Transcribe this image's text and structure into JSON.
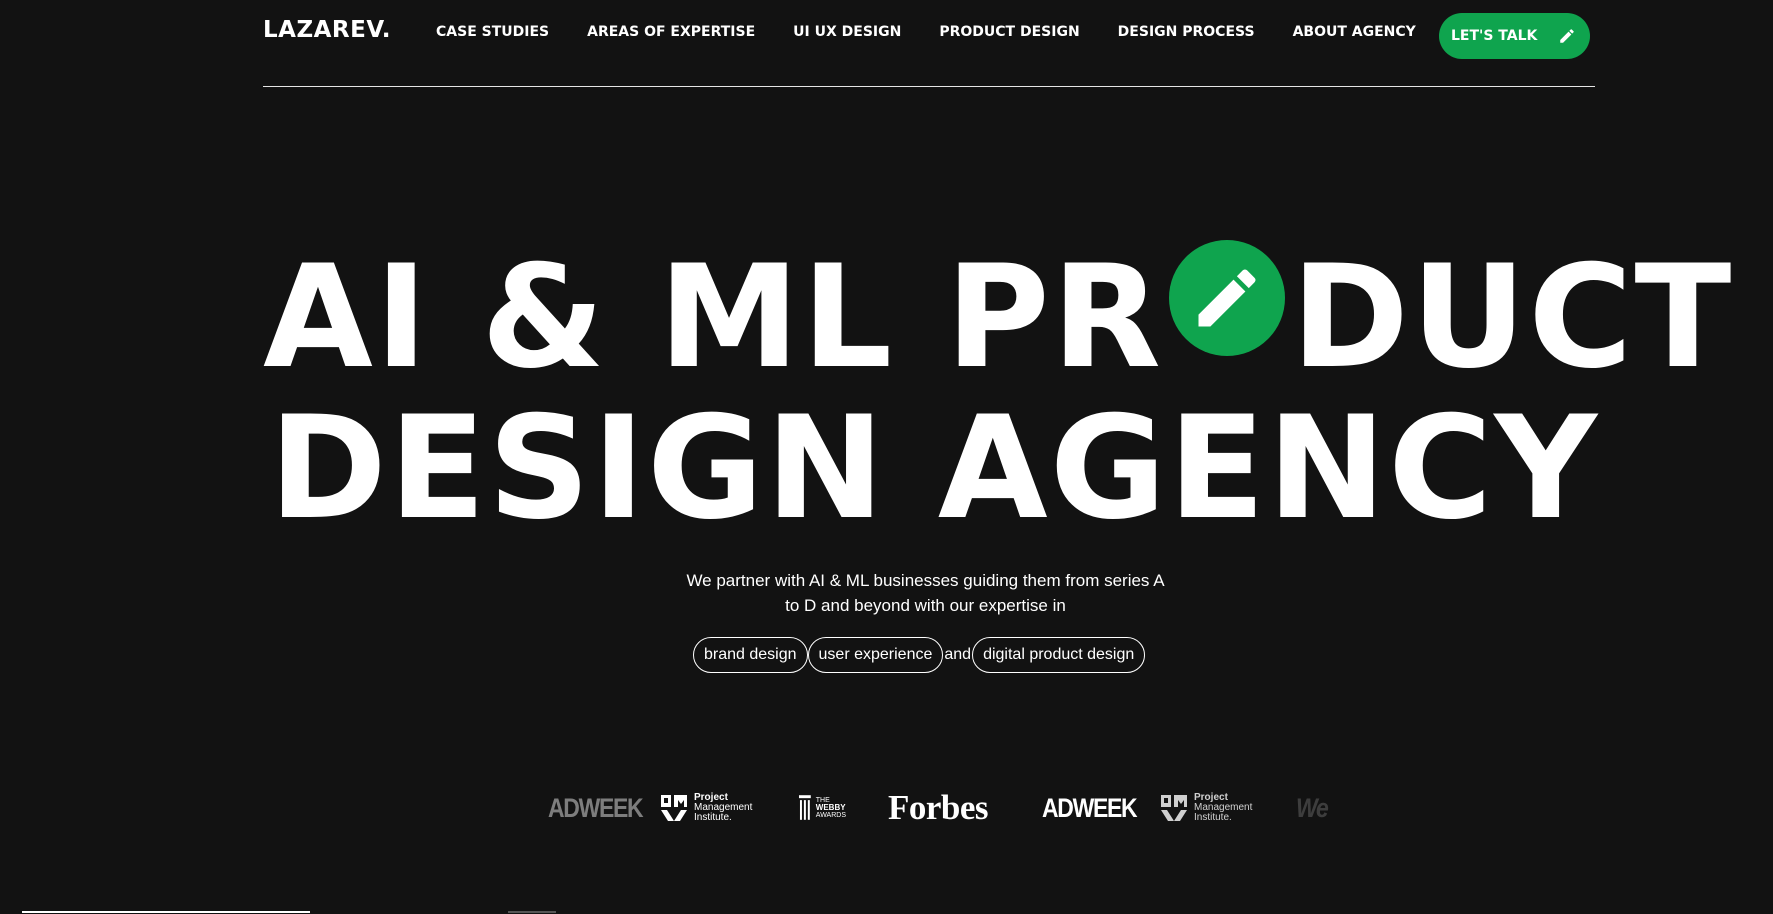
{
  "header": {
    "logo": "LAZAREV.",
    "nav": [
      {
        "label": "CASE STUDIES"
      },
      {
        "label": "AREAS OF EXPERTISE"
      },
      {
        "label": "UI UX DESIGN"
      },
      {
        "label": "PRODUCT DESIGN"
      },
      {
        "label": "DESIGN PROCESS"
      },
      {
        "label": "ABOUT AGENCY"
      }
    ],
    "cta_label": "LET'S TALK",
    "cta_icon": "pencil-icon"
  },
  "hero": {
    "line1_a": "AI & ML PR",
    "line1_b": "DUCT",
    "line2": "DESIGN AGENCY",
    "badge_icon": "pencil-icon",
    "description": "We partner with AI & ML businesses guiding them from series A to D and beyond with our expertise in",
    "tags": [
      "brand design",
      "user experience",
      "digital product design"
    ],
    "and_text": "and"
  },
  "logos": {
    "adweek": "ADWEEK",
    "pmi_line1": "Project",
    "pmi_line2": "Management",
    "pmi_line3": "Institute.",
    "webby_line1": "THE",
    "webby_line2": "WEBBY",
    "webby_line3": "AWARDS",
    "forbes": "Forbes",
    "partial": "We"
  },
  "colors": {
    "background": "#121212",
    "accent": "#0fa44e",
    "text": "#ffffff"
  }
}
